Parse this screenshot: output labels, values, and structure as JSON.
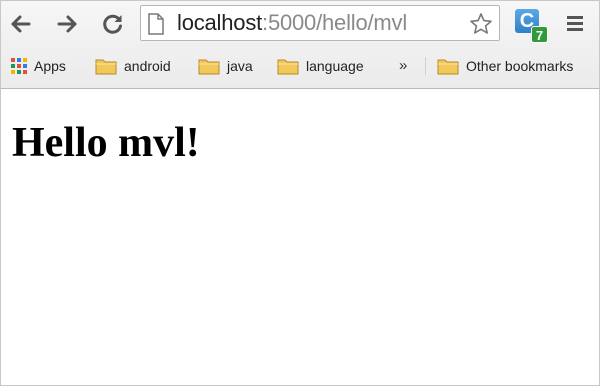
{
  "toolbar": {
    "back_icon": "arrow-left",
    "forward_icon": "arrow-right",
    "reload_icon": "reload",
    "menu_icon": "hamburger"
  },
  "omnibox": {
    "host": "localhost",
    "path": ":5000/hello/mvl",
    "bookmark_icon": "star-outline"
  },
  "extension": {
    "letter": "C",
    "badge": "7"
  },
  "bookmarks_bar": {
    "apps_label": "Apps",
    "items": [
      {
        "label": "android",
        "icon": "folder"
      },
      {
        "label": "java",
        "icon": "folder"
      },
      {
        "label": "language",
        "icon": "folder"
      }
    ],
    "overflow": "»",
    "other_bookmarks": "Other bookmarks"
  },
  "page": {
    "heading": "Hello mvl!"
  },
  "colors": {
    "folder": "#f2c85b",
    "extension": "#3a8fd6",
    "badge": "#2f9b3b"
  }
}
